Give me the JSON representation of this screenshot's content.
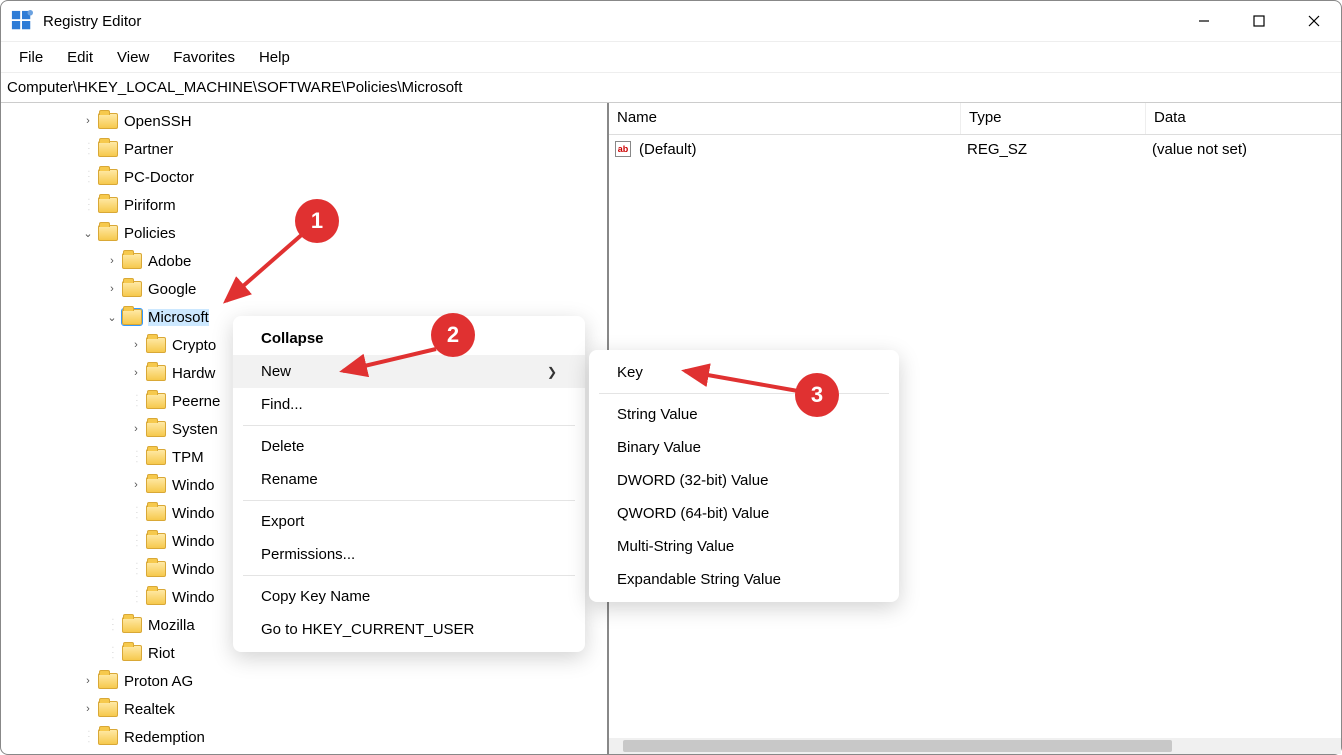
{
  "window": {
    "title": "Registry Editor"
  },
  "menu": {
    "file": "File",
    "edit": "Edit",
    "view": "View",
    "favorites": "Favorites",
    "help": "Help"
  },
  "address": "Computer\\HKEY_LOCAL_MACHINE\\SOFTWARE\\Policies\\Microsoft",
  "tree": {
    "items": [
      {
        "indent": 80,
        "chev": ">",
        "label": "OpenSSH"
      },
      {
        "indent": 80,
        "chev": "",
        "label": "Partner"
      },
      {
        "indent": 80,
        "chev": "",
        "label": "PC-Doctor"
      },
      {
        "indent": 80,
        "chev": "",
        "label": "Piriform"
      },
      {
        "indent": 80,
        "chev": "v",
        "label": "Policies"
      },
      {
        "indent": 104,
        "chev": ">",
        "label": "Adobe"
      },
      {
        "indent": 104,
        "chev": ">",
        "label": "Google"
      },
      {
        "indent": 104,
        "chev": "v",
        "label": "Microsoft",
        "selected": true
      },
      {
        "indent": 128,
        "chev": ">",
        "label": "Crypto"
      },
      {
        "indent": 128,
        "chev": ">",
        "label": "Hardw"
      },
      {
        "indent": 128,
        "chev": "",
        "label": "Peerne"
      },
      {
        "indent": 128,
        "chev": ">",
        "label": "Systen"
      },
      {
        "indent": 128,
        "chev": "",
        "label": "TPM"
      },
      {
        "indent": 128,
        "chev": ">",
        "label": "Windo"
      },
      {
        "indent": 128,
        "chev": "",
        "label": "Windo"
      },
      {
        "indent": 128,
        "chev": "",
        "label": "Windo"
      },
      {
        "indent": 128,
        "chev": "",
        "label": "Windo"
      },
      {
        "indent": 128,
        "chev": "",
        "label": "Windo"
      },
      {
        "indent": 104,
        "chev": "",
        "label": "Mozilla"
      },
      {
        "indent": 104,
        "chev": "",
        "label": "Riot"
      },
      {
        "indent": 80,
        "chev": ">",
        "label": "Proton AG"
      },
      {
        "indent": 80,
        "chev": ">",
        "label": "Realtek"
      },
      {
        "indent": 80,
        "chev": "",
        "label": "Redemption"
      }
    ]
  },
  "list": {
    "columns": {
      "name": "Name",
      "type": "Type",
      "data": "Data"
    },
    "rows": [
      {
        "name": "(Default)",
        "type": "REG_SZ",
        "data": "(value not set)"
      }
    ]
  },
  "context_menu": {
    "collapse": "Collapse",
    "new": "New",
    "find": "Find...",
    "delete": "Delete",
    "rename": "Rename",
    "export": "Export",
    "permissions": "Permissions...",
    "copy_key_name": "Copy Key Name",
    "goto": "Go to HKEY_CURRENT_USER"
  },
  "submenu": {
    "key": "Key",
    "string": "String Value",
    "binary": "Binary Value",
    "dword": "DWORD (32-bit) Value",
    "qword": "QWORD (64-bit) Value",
    "multi": "Multi-String Value",
    "expand": "Expandable String Value"
  },
  "callouts": {
    "one": "1",
    "two": "2",
    "three": "3"
  }
}
